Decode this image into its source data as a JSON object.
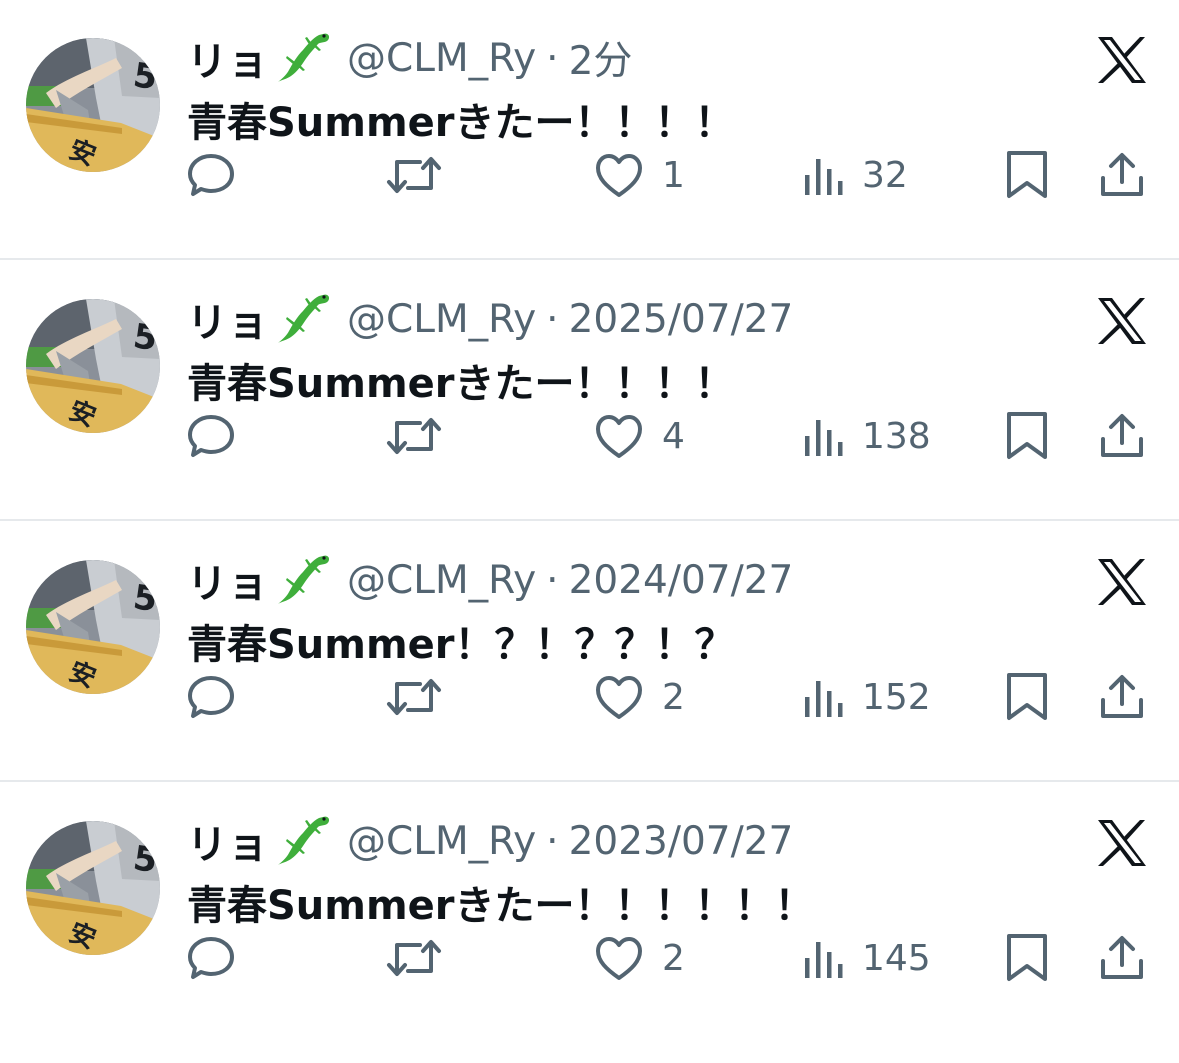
{
  "tweets": [
    {
      "name": "リョ",
      "handle": "@CLM_Ry",
      "separator": "·",
      "time": "2分",
      "text": "青春Summerきたー！！！！",
      "likes": "1",
      "views": "32"
    },
    {
      "name": "リョ",
      "handle": "@CLM_Ry",
      "separator": "·",
      "time": "2025/07/27",
      "text": "青春Summerきたー！！！！",
      "likes": "4",
      "views": "138"
    },
    {
      "name": "リョ",
      "handle": "@CLM_Ry",
      "separator": "·",
      "time": "2024/07/27",
      "text": "青春Summer！？！？？！？",
      "likes": "2",
      "views": "152"
    },
    {
      "name": "リョ",
      "handle": "@CLM_Ry",
      "separator": "·",
      "time": "2023/07/27",
      "text": "青春Summerきたー！！！！！！",
      "likes": "2",
      "views": "145"
    }
  ],
  "icons": {
    "name_emoji": "lizard-icon",
    "platform": "x-logo-icon",
    "reply": "reply-icon",
    "retweet": "retweet-icon",
    "like": "heart-icon",
    "views": "views-icon",
    "bookmark": "bookmark-icon",
    "share": "share-icon"
  },
  "avatar_badge": "安",
  "colors": {
    "text": "#0f1419",
    "secondary": "#536471",
    "divider": "#e6e9ec",
    "lizard": "#3fae3b"
  }
}
